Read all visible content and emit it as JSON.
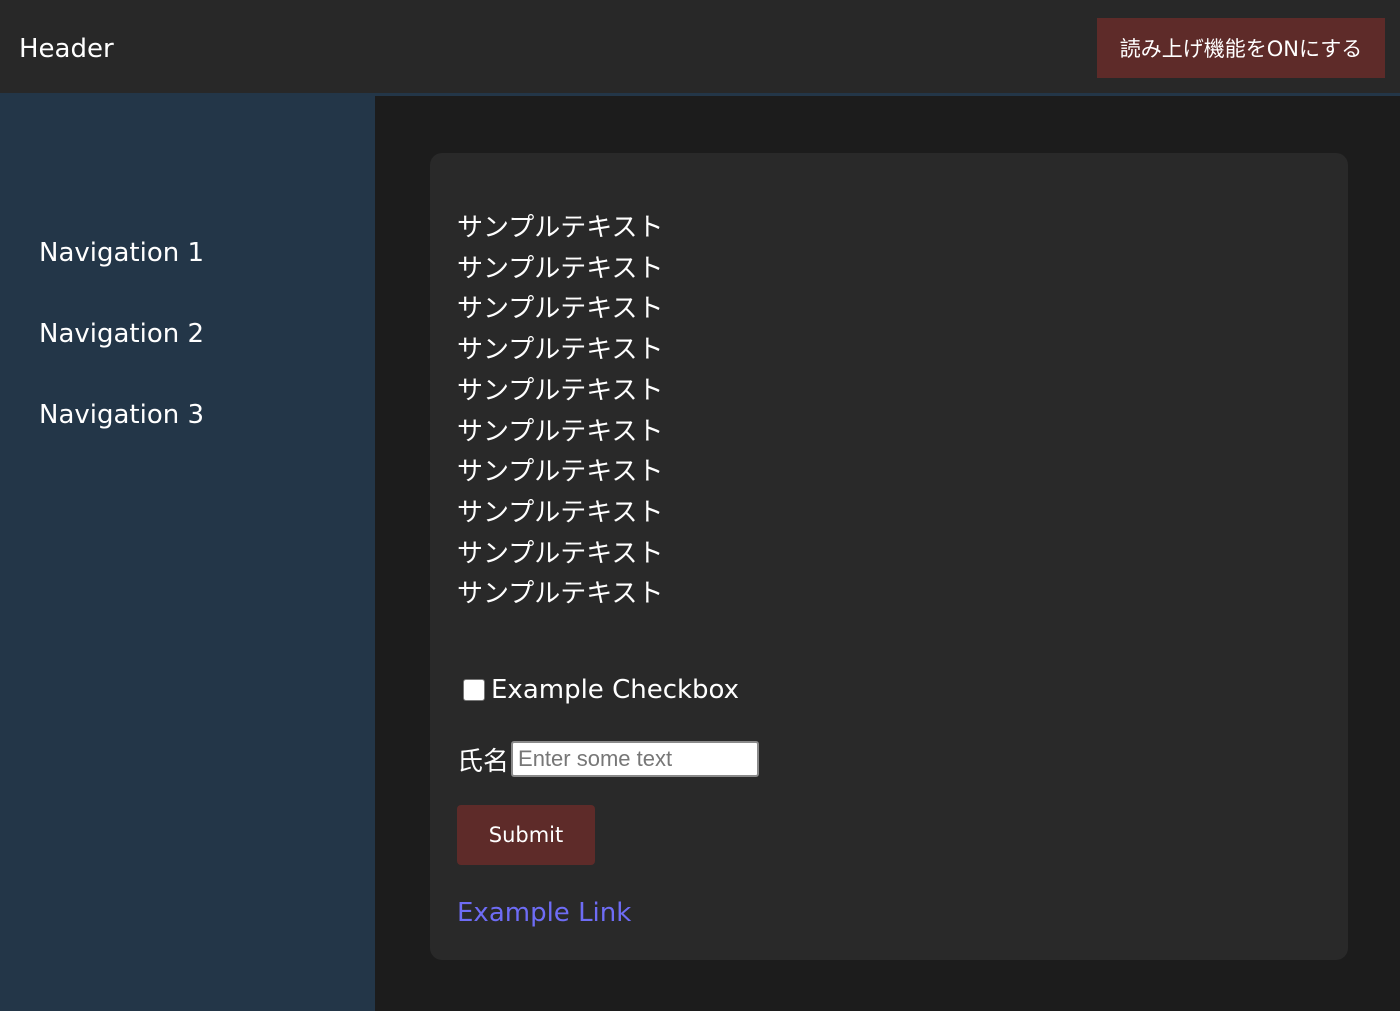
{
  "header": {
    "title": "Header",
    "read_aloud_button": "読み上げ機能をONにする"
  },
  "sidebar": {
    "items": [
      {
        "label": "Navigation 1"
      },
      {
        "label": "Navigation 2"
      },
      {
        "label": "Navigation 3"
      }
    ]
  },
  "main": {
    "sample_lines": [
      "サンプルテキスト",
      "サンプルテキスト",
      "サンプルテキスト",
      "サンプルテキスト",
      "サンプルテキスト",
      "サンプルテキスト",
      "サンプルテキスト",
      "サンプルテキスト",
      "サンプルテキスト",
      "サンプルテキスト"
    ],
    "checkbox": {
      "label": "Example Checkbox",
      "checked": false
    },
    "name_field": {
      "label": "氏名",
      "value": "",
      "placeholder": "Enter some text"
    },
    "submit_label": "Submit",
    "link_label": "Example Link"
  },
  "colors": {
    "header_bg": "#282828",
    "sidebar_bg": "#233648",
    "content_bg": "#1c1c1c",
    "card_bg": "#292929",
    "button_bg": "#5e2b29",
    "link": "#6e6cf5"
  }
}
